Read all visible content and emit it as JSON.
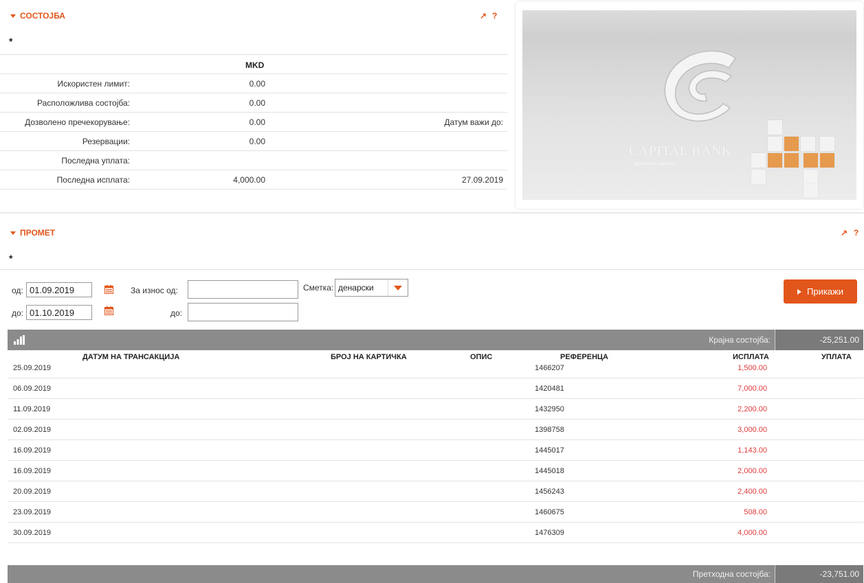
{
  "balance": {
    "title": "СОСТОЈБА",
    "tool_expand": "↗",
    "tool_help": "?",
    "star": "*",
    "currency": "MKD",
    "rows": [
      {
        "label": "Искористен лимит:",
        "value": "0.00",
        "date_label": "",
        "date": ""
      },
      {
        "label": "Расположлива состојба:",
        "value": "0.00",
        "date_label": "",
        "date": ""
      },
      {
        "label": "Дозволено пречекорување:",
        "value": "0.00",
        "date_label": "Датум важи до:",
        "date": ""
      },
      {
        "label": "Резервации:",
        "value": "0.00",
        "date_label": "",
        "date": ""
      },
      {
        "label": "Последна уплата:",
        "value": "",
        "date_label": "",
        "date": ""
      },
      {
        "label": "Последна исплата:",
        "value": "4,000.00",
        "date_label": "",
        "date": "27.09.2019"
      }
    ]
  },
  "card": {
    "bank_name": "CAPITAL BANK",
    "tagline": "финансиски партнер",
    "colors": {
      "accent": "#e69a4d",
      "background": "#d9d9d9"
    }
  },
  "transactions": {
    "title": "ПРОМЕТ",
    "tool_expand": "↗",
    "tool_help": "?",
    "star": "*",
    "filters": {
      "from_label": "од:",
      "from_value": "01.09.2019",
      "to_label": "до:",
      "to_value": "01.10.2019",
      "amount_from_label": "За износ од:",
      "amount_to_label": "до:",
      "amount_from_value": "",
      "amount_to_value": "",
      "account_label": "Сметка:",
      "account_value": "денарски",
      "show_button": "Прикажи"
    },
    "final_balance_label": "Крајна состојба:",
    "final_balance_value": "-25,251.00",
    "prev_balance_label": "Претходна состојба:",
    "prev_balance_value": "-23,751.00",
    "columns": [
      "ДАТУМ НА ТРАНСАКЦИЈА",
      "БРОЈ НА КАРТИЧКА",
      "ОПИС",
      "РЕФЕРЕНЦА",
      "ИСПЛАТА",
      "УПЛАТА"
    ],
    "rows": [
      {
        "date": "25.09.2019",
        "card": "",
        "desc": "",
        "ref": "1466207",
        "payout": "1,500.00",
        "payin": ""
      },
      {
        "date": "06.09.2019",
        "card": "",
        "desc": "",
        "ref": "1420481",
        "payout": "7,000.00",
        "payin": ""
      },
      {
        "date": "11.09.2019",
        "card": "",
        "desc": "",
        "ref": "1432950",
        "payout": "2,200.00",
        "payin": ""
      },
      {
        "date": "02.09.2019",
        "card": "",
        "desc": "",
        "ref": "1398758",
        "payout": "3,000.00",
        "payin": ""
      },
      {
        "date": "16.09.2019",
        "card": "",
        "desc": "",
        "ref": "1445017",
        "payout": "1,143.00",
        "payin": ""
      },
      {
        "date": "16.09.2019",
        "card": "",
        "desc": "",
        "ref": "1445018",
        "payout": "2,000.00",
        "payin": ""
      },
      {
        "date": "20.09.2019",
        "card": "",
        "desc": "",
        "ref": "1456243",
        "payout": "2,400.00",
        "payin": ""
      },
      {
        "date": "23.09.2019",
        "card": "",
        "desc": "",
        "ref": "1460675",
        "payout": "508.00",
        "payin": ""
      },
      {
        "date": "30.09.2019",
        "card": "",
        "desc": "",
        "ref": "1476309",
        "payout": "4,000.00",
        "payin": ""
      }
    ],
    "colors": {
      "accent": "#e2561b",
      "negative": "#e03a3a",
      "bar": "#8b8b8b"
    }
  }
}
